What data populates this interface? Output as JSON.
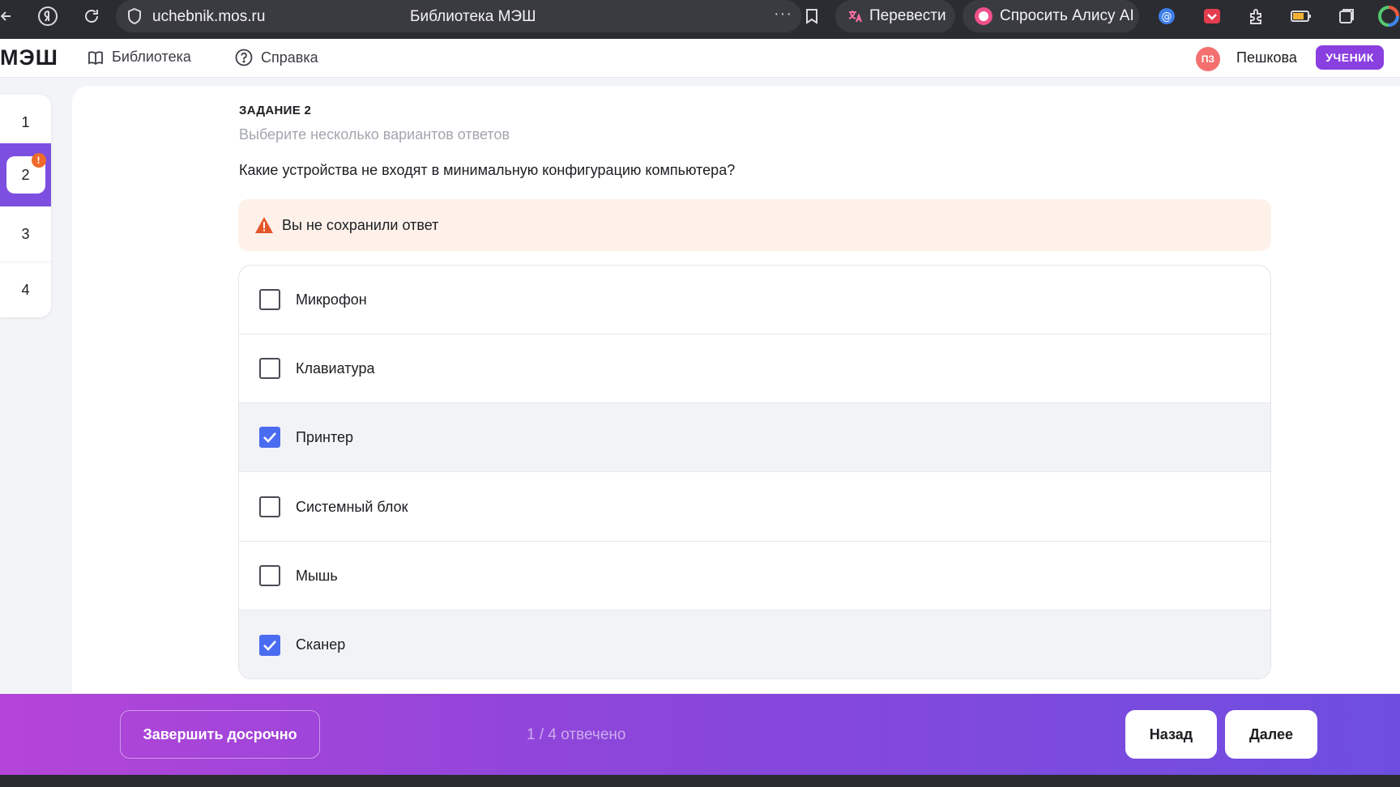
{
  "browser": {
    "url": "uchebnik.mos.ru",
    "title": "Библиотека МЭШ",
    "translate_label": "Перевести",
    "alice_label": "Спросить Алису AI"
  },
  "header": {
    "logo": "МЭШ",
    "nav": [
      "Библиотека",
      "Справка"
    ],
    "avatar_initials": "ПЗ",
    "username": "Пешкова",
    "role": "УЧЕНИК"
  },
  "question_nav": {
    "items": [
      "1",
      "2",
      "3",
      "4"
    ],
    "active": "2",
    "warning_badge": "!"
  },
  "task": {
    "label": "ЗАДАНИЕ 2",
    "hint": "Выберите несколько вариантов ответов",
    "question": "Какие устройства не входят в минимальную конфигурацию компьютера?",
    "warning": "Вы не сохранили ответ",
    "options": [
      {
        "label": "Микрофон",
        "checked": false
      },
      {
        "label": "Клавиатура",
        "checked": false
      },
      {
        "label": "Принтер",
        "checked": true
      },
      {
        "label": "Системный блок",
        "checked": false
      },
      {
        "label": "Мышь",
        "checked": false
      },
      {
        "label": "Сканер",
        "checked": true
      }
    ]
  },
  "footer": {
    "finish_label": "Завершить досрочно",
    "progress": "1 / 4 отвечено",
    "back_label": "Назад",
    "next_label": "Далее"
  },
  "colors": {
    "accent": "#7c4fe0",
    "checkbox": "#4a6cf0",
    "warning": "#e5562a",
    "role_badge": "#8a3fe0"
  }
}
